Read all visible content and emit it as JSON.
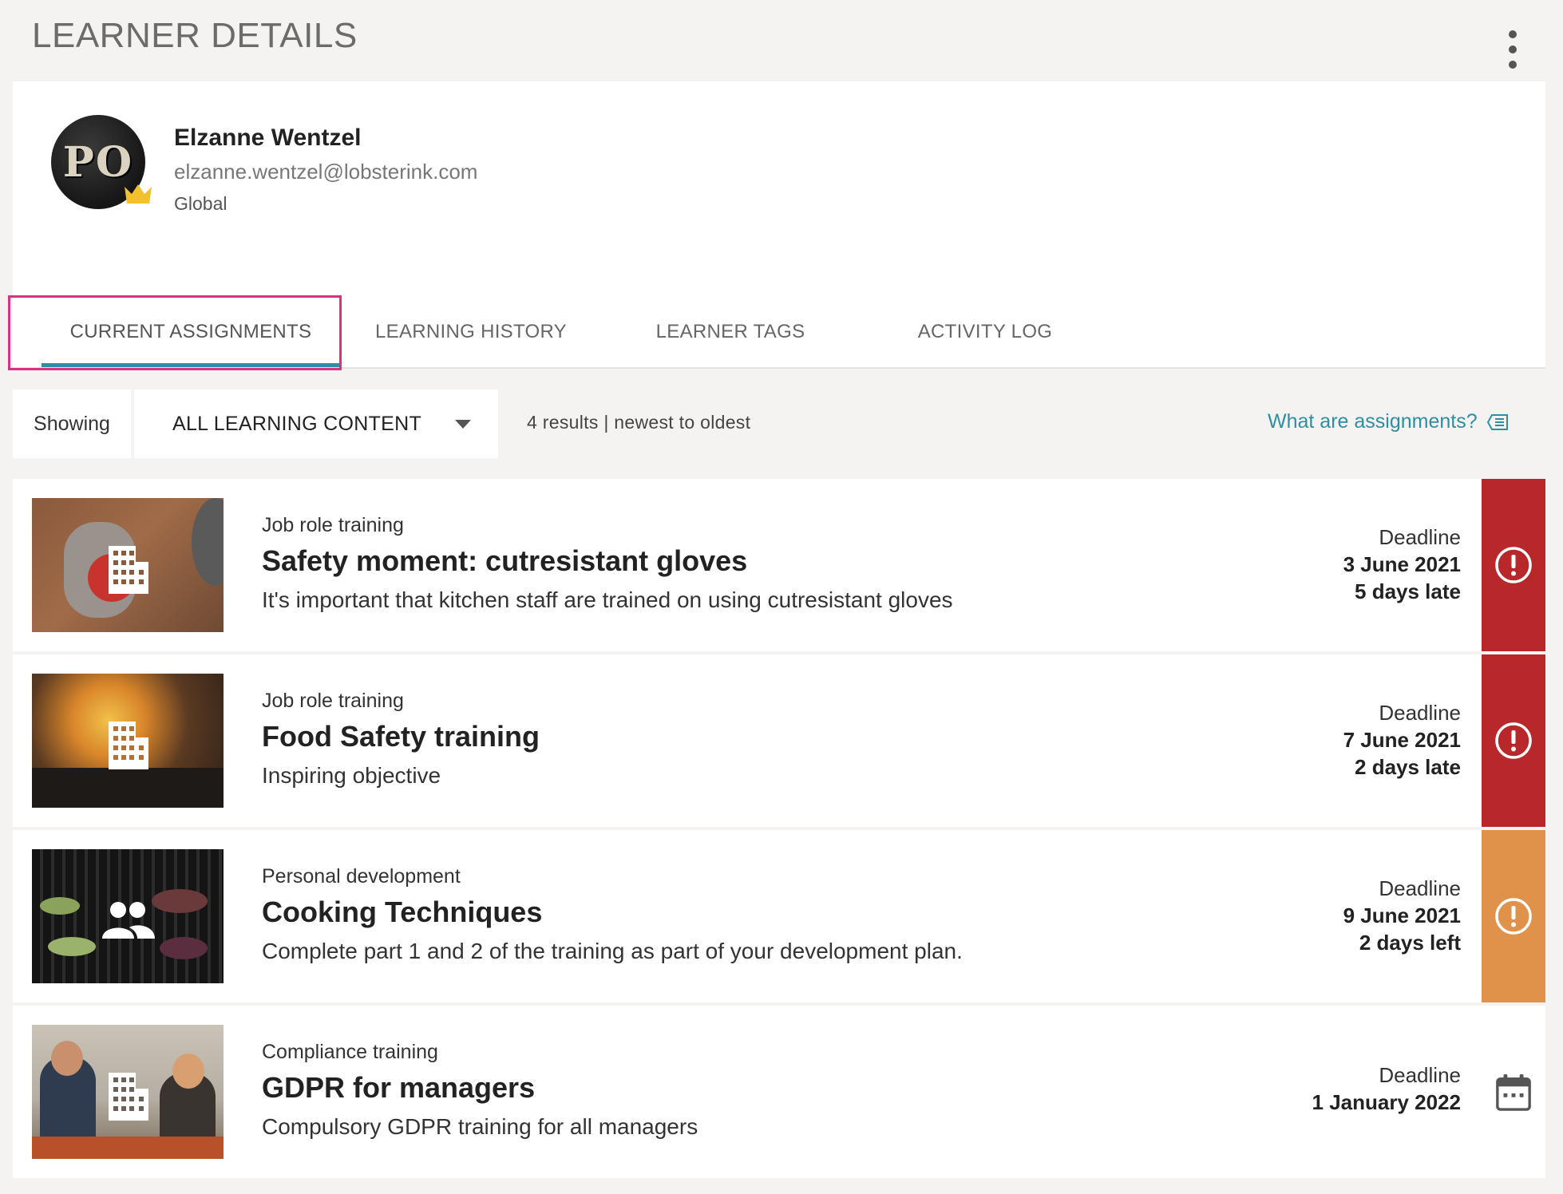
{
  "header": {
    "title": "LEARNER DETAILS"
  },
  "profile": {
    "initials": "PO",
    "name": "Elzanne Wentzel",
    "email": "elzanne.wentzel@lobsterink.com",
    "region": "Global"
  },
  "tabs": [
    {
      "label": "CURRENT ASSIGNMENTS",
      "active": true
    },
    {
      "label": "LEARNING HISTORY",
      "active": false
    },
    {
      "label": "LEARNER TAGS",
      "active": false
    },
    {
      "label": "ACTIVITY LOG",
      "active": false
    }
  ],
  "filter": {
    "showing_label": "Showing",
    "selected": "ALL LEARNING CONTENT",
    "results": "4 results | newest to oldest",
    "help_link": "What are assignments?"
  },
  "colors": {
    "accent": "#2d8fa1",
    "overdue": "#b8282a",
    "due_soon": "#e0924a",
    "tab_highlight": "#d63384"
  },
  "assignments": [
    {
      "category": "Job role training",
      "title": "Safety moment: cutresistant gloves",
      "description": "It's important that kitchen staff are trained on using cutresistant gloves",
      "deadline_label": "Deadline",
      "deadline_date": "3 June 2021",
      "deadline_status": "5 days late",
      "status": "overdue",
      "type_icon": "building-icon"
    },
    {
      "category": "Job role training",
      "title": "Food Safety training",
      "description": "Inspiring objective",
      "deadline_label": "Deadline",
      "deadline_date": "7 June 2021",
      "deadline_status": "2 days late",
      "status": "overdue",
      "type_icon": "building-icon"
    },
    {
      "category": "Personal development",
      "title": "Cooking Techniques",
      "description": "Complete part 1 and 2 of the training as part of your development plan.",
      "deadline_label": "Deadline",
      "deadline_date": "9 June 2021",
      "deadline_status": "2 days left",
      "status": "due-soon",
      "type_icon": "people-icon"
    },
    {
      "category": "Compliance training",
      "title": "GDPR for managers",
      "description": "Compulsory GDPR training for all managers",
      "deadline_label": "Deadline",
      "deadline_date": "1 January 2022",
      "deadline_status": "",
      "status": "scheduled",
      "type_icon": "building-icon"
    }
  ]
}
